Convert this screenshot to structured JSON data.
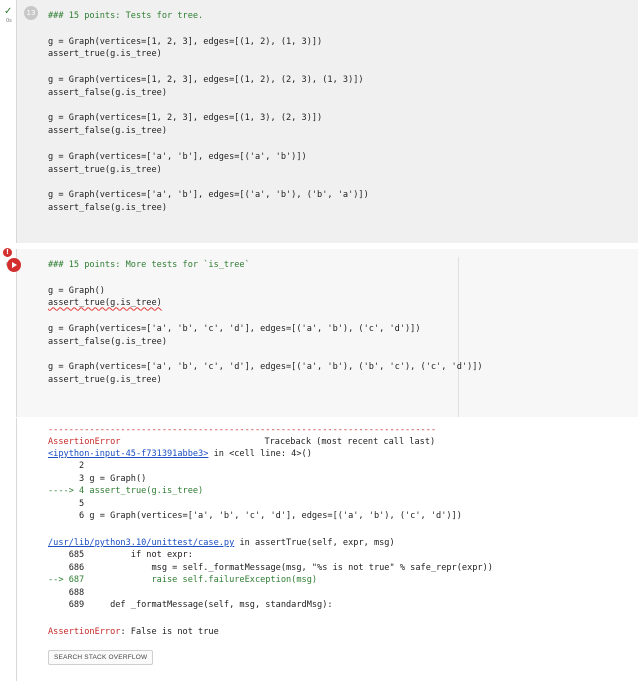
{
  "gutter": {
    "cell1_status": "✓",
    "cell1_time": "0s",
    "cell2_status": "!",
    "cell2_time": "0s"
  },
  "cell1": {
    "exec_count": "13",
    "lines": [
      "### 15 points: Tests for tree.",
      "",
      "g = Graph(vertices=[1, 2, 3], edges=[(1, 2), (1, 3)])",
      "assert_true(g.is_tree)",
      "",
      "g = Graph(vertices=[1, 2, 3], edges=[(1, 2), (2, 3), (1, 3)])",
      "assert_false(g.is_tree)",
      "",
      "g = Graph(vertices=[1, 2, 3], edges=[(1, 3), (2, 3)])",
      "assert_false(g.is_tree)",
      "",
      "g = Graph(vertices=['a', 'b'], edges=[('a', 'b')])",
      "assert_true(g.is_tree)",
      "",
      "g = Graph(vertices=['a', 'b'], edges=[('a', 'b'), ('b', 'a')])",
      "assert_false(g.is_tree)"
    ]
  },
  "cell2": {
    "lines": [
      "### 15 points: More tests for `is_tree`",
      "",
      "g = Graph()",
      "assert_true(g.is_tree)",
      "",
      "g = Graph(vertices=['a', 'b', 'c', 'd'], edges=[('a', 'b'), ('c', 'd')])",
      "assert_false(g.is_tree)",
      "",
      "g = Graph(vertices=['a', 'b', 'c', 'd'], edges=[('a', 'b'), ('b', 'c'), ('c', 'd')])",
      "assert_true(g.is_tree)"
    ]
  },
  "output": {
    "dashes": "---------------------------------------------------------------------------",
    "error_name": "AssertionError",
    "traceback_header": "Traceback (most recent call last)",
    "frame1_link": "<ipython-input-45-f731391abbe3>",
    "frame1_in": " in <cell line: 4>()",
    "frame1_lines": [
      "      2",
      "      3 g = Graph()",
      "----> 4 assert_true(g.is_tree)",
      "      5",
      "      6 g = Graph(vertices=['a', 'b', 'c', 'd'], edges=[('a', 'b'), ('c', 'd')])"
    ],
    "frame2_link": "/usr/lib/python3.10/unittest/case.py",
    "frame2_in": " in assertTrue(self, expr, msg)",
    "frame2_lines": [
      "    685         if not expr:",
      "    686             msg = self._formatMessage(msg, \"%s is not true\" % safe_repr(expr))",
      "--> 687             raise self.failureException(msg)",
      "    688",
      "    689     def _formatMessage(self, msg, standardMsg):"
    ],
    "final_error_name": "AssertionError",
    "final_error_msg": ": False is not true",
    "stack_overflow_button": "SEARCH STACK OVERFLOW"
  }
}
